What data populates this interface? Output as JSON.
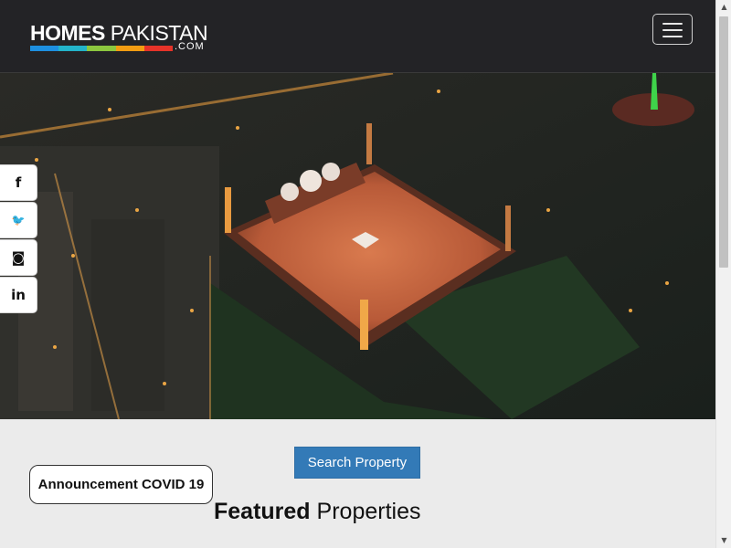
{
  "brand": {
    "name_bold": "HOMES",
    "name_light": "PAKISTAN",
    "domain": ".COM",
    "bar_colors": [
      "#1d8fe0",
      "#23b3c9",
      "#8cc63f",
      "#f39c12",
      "#e63329"
    ]
  },
  "navbar": {
    "menu_icon": "hamburger-menu-icon"
  },
  "social": [
    {
      "name": "facebook",
      "icon": "facebook-icon",
      "glyph": "f"
    },
    {
      "name": "twitter",
      "icon": "twitter-icon",
      "glyph": "🐦"
    },
    {
      "name": "instagram",
      "icon": "instagram-icon",
      "glyph": "◙"
    },
    {
      "name": "linkedin",
      "icon": "linkedin-icon",
      "glyph": "in"
    }
  ],
  "hero": {
    "scene": "night aerial view of mosque courtyard lit with lights"
  },
  "actions": {
    "search_label": "Search Property",
    "announcement_label": "Announcement COVID 19"
  },
  "featured": {
    "bold": "Featured",
    "light": "Properties"
  },
  "colors": {
    "navbar_bg": "#232326",
    "primary_button": "#337ab7",
    "page_bg": "#ebebeb"
  }
}
